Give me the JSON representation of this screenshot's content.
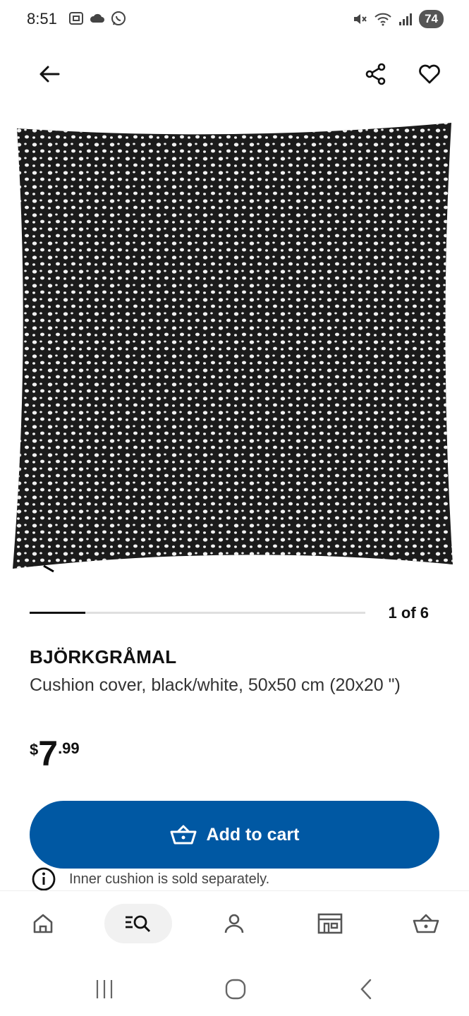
{
  "status_bar": {
    "time": "8:51",
    "battery": "74",
    "left_icons": [
      "screenshot-icon",
      "cloud-icon",
      "whatsapp-icon"
    ],
    "right_icons": [
      "mute-icon",
      "wifi-icon",
      "signal-icon"
    ]
  },
  "top_bar": {
    "icons": [
      "back-arrow-icon",
      "share-icon",
      "heart-icon"
    ]
  },
  "product": {
    "image_icon": "cushion-image",
    "name": "BJÖRKGRÅMAL",
    "description": "Cushion cover, black/white, 50x50 cm (20x20 \")",
    "price": {
      "currency": "$",
      "integer": "7",
      "decimal": ".99"
    }
  },
  "carousel": {
    "label": "1 of 6",
    "current": 1,
    "total": 6
  },
  "cart": {
    "label": "Add to cart",
    "icon": "basket-icon",
    "accent": "#0058a3"
  },
  "notice": {
    "icon": "info-icon",
    "text": "Inner cushion is sold separately."
  },
  "bottom_nav": {
    "items": [
      {
        "icon": "home-icon",
        "active": false
      },
      {
        "icon": "search-list-icon",
        "active": true
      },
      {
        "icon": "profile-icon",
        "active": false
      },
      {
        "icon": "store-icon",
        "active": false
      },
      {
        "icon": "basket-icon",
        "active": false
      }
    ]
  },
  "system_nav": {
    "icons": [
      "recents-icon",
      "home-circle-icon",
      "back-chevron-icon"
    ]
  }
}
